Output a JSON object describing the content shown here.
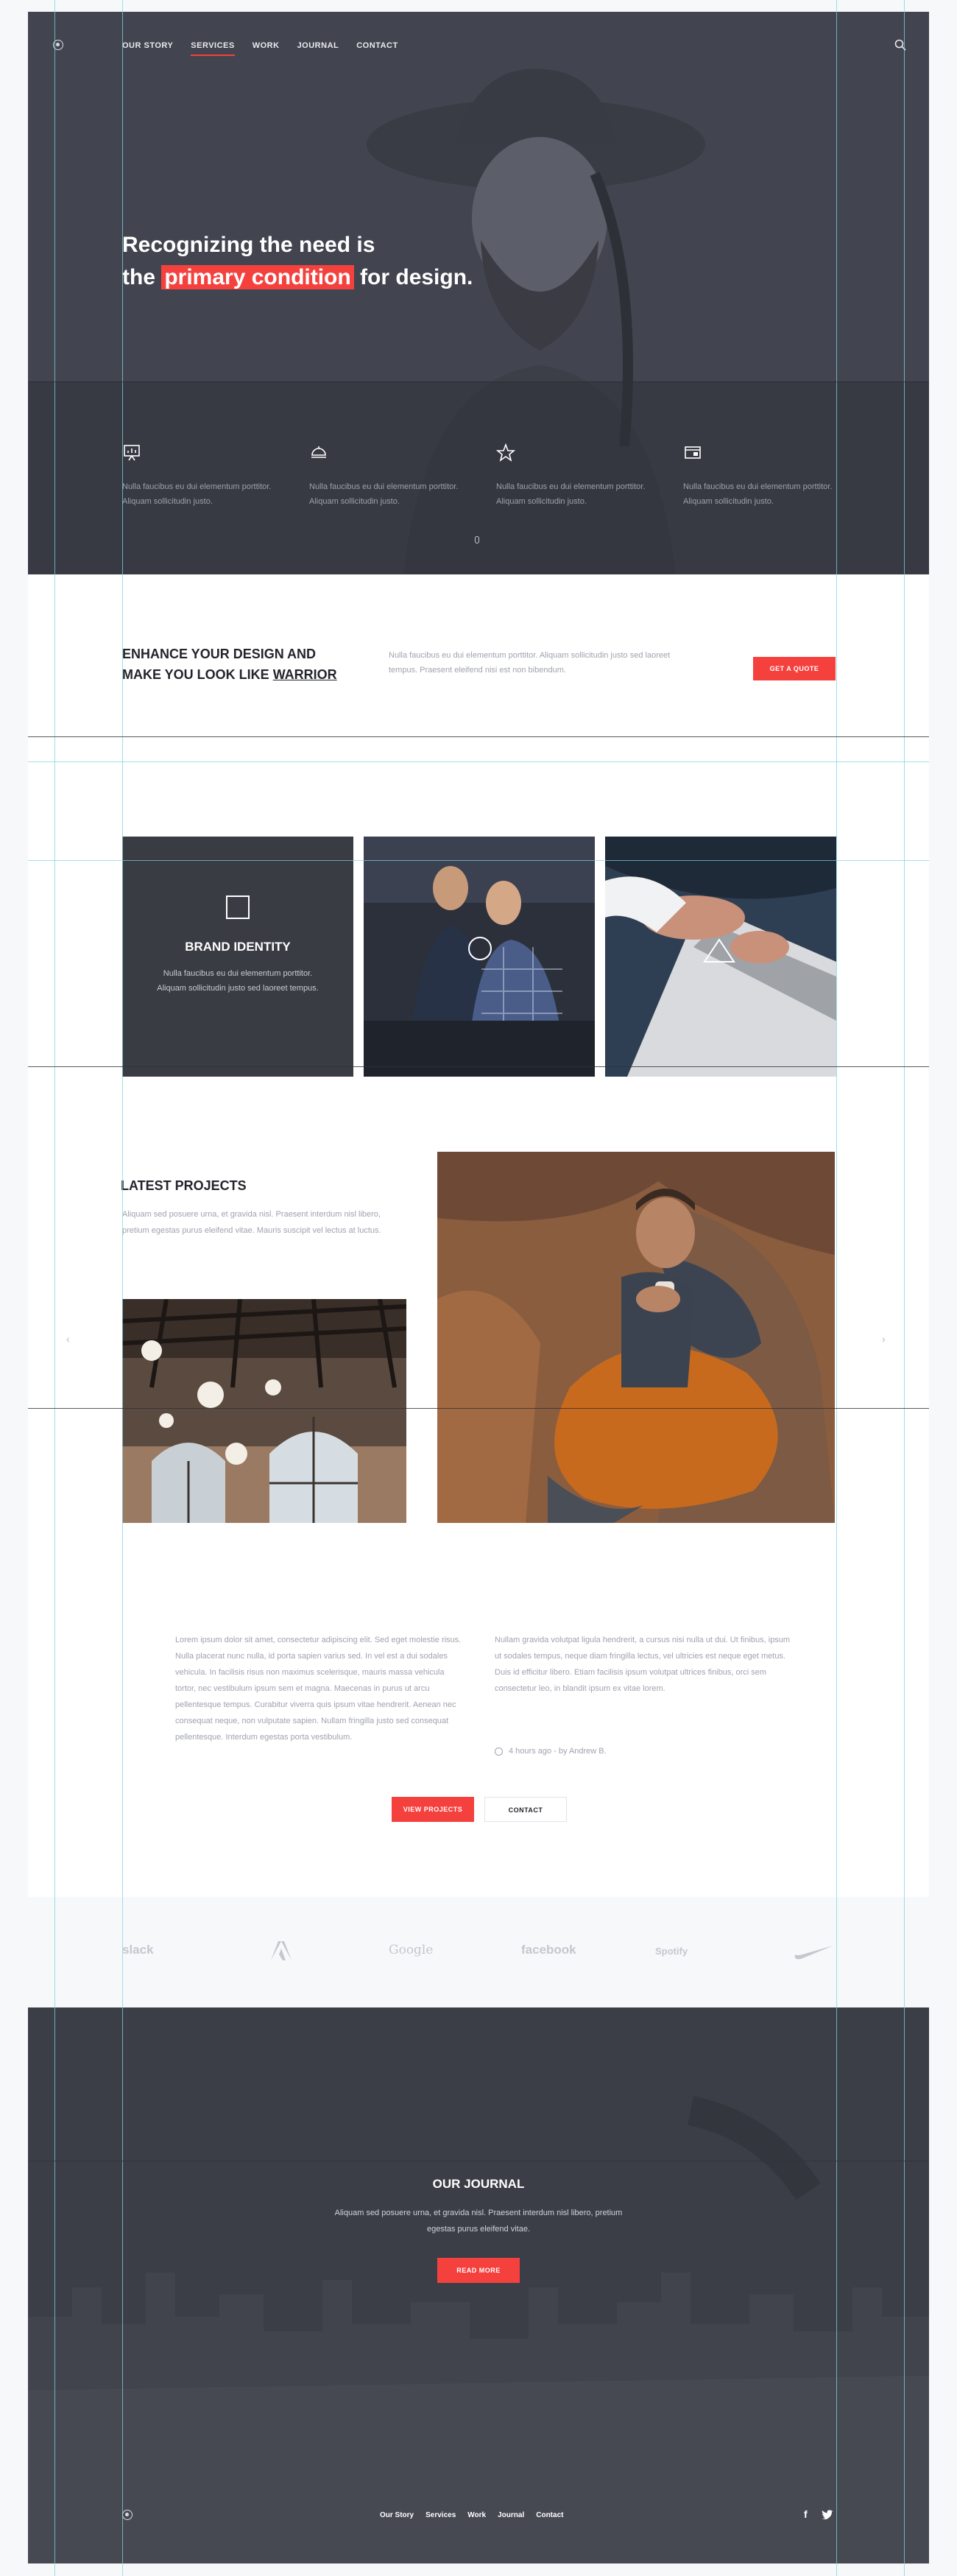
{
  "nav": {
    "items": [
      "OUR STORY",
      "SERVICES",
      "WORK",
      "JOURNAL",
      "CONTACT"
    ],
    "active": "SERVICES"
  },
  "hero": {
    "line1": "Recognizing the need is",
    "line2_pre": "the ",
    "line2_highlight": "primary condition",
    "line2_post": " for design.",
    "features": [
      {
        "icon": "presentation-icon",
        "text": "Nulla faucibus eu dui elementum porttitor. Aliquam sollicitudin justo."
      },
      {
        "icon": "dome-icon",
        "text": "Nulla faucibus eu dui elementum porttitor. Aliquam sollicitudin justo."
      },
      {
        "icon": "star-icon",
        "text": "Nulla faucibus eu dui elementum porttitor. Aliquam sollicitudin justo."
      },
      {
        "icon": "browser-icon",
        "text": "Nulla faucibus eu dui elementum porttitor. Aliquam sollicitudin justo."
      }
    ]
  },
  "cta": {
    "title_line1": "ENHANCE YOUR DESIGN AND",
    "title_line2_pre": "MAKE YOU LOOK LIKE ",
    "title_line2_ul": "WARRIOR",
    "text": "Nulla faucibus eu dui elementum porttitor. Aliquam sollicitudin justo sed laoreet tempus. Praesent eleifend nisi est non bibendum.",
    "button": "GET A QUOTE"
  },
  "services": {
    "card_title": "BRAND IDENTITY",
    "card_text": "Nulla faucibus eu dui elementum porttitor. Aliquam sollicitudin justo sed laoreet tempus."
  },
  "projects": {
    "title": "LATEST PROJECTS",
    "text": "Aliquam sed posuere urna, et gravida nisl. Praesent interdum nisl libero, pretium egestas purus eleifend vitae. Mauris suscipit vel lectus at luctus.",
    "prev": "‹",
    "next": "›"
  },
  "article": {
    "col1": "Lorem ipsum dolor sit amet, consectetur adipiscing elit. Sed eget molestie risus. Nulla placerat nunc nulla, id porta sapien varius sed. In vel est a dui sodales vehicula. In facilisis risus non maximus scelerisque, mauris massa vehicula tortor, nec vestibulum ipsum sem et magna. Maecenas in purus ut arcu pellentesque tempus. Curabitur viverra quis ipsum vitae hendrerit. Aenean nec consequat neque, non vulputate sapien. Nullam fringilla justo sed consequat pellentesque. Interdum egestas porta vestibulum.",
    "col2": "Nullam gravida volutpat ligula hendrerit, a cursus nisi nulla ut dui. Ut finibus, ipsum ut sodales tempus, neque diam fringilla lectus, vel ultricies est neque eget metus. Duis id efficitur libero. Etiam facilisis ipsum volutpat ultrices finibus, orci sem consectetur leo, in blandit ipsum ex vitae lorem.",
    "meta": "4 hours ago - by Andrew B.",
    "view_button": "VIEW PROJECTS",
    "contact_button": "CONTACT"
  },
  "brands": [
    "slack",
    "Adobe",
    "Google",
    "facebook",
    "Spotify",
    "Nike"
  ],
  "journal": {
    "title": "OUR JOURNAL",
    "text": "Aliquam sed posuere urna, et gravida nisl. Praesent interdum nisl libero, pretium egestas purus eleifend vitae.",
    "button": "READ MORE"
  },
  "footer": {
    "links": [
      "Our Story",
      "Services",
      "Work",
      "Journal",
      "Contact"
    ],
    "social": [
      "f",
      "twitter"
    ]
  },
  "colors": {
    "accent": "#f5413e",
    "dark": "#3c3e47"
  }
}
